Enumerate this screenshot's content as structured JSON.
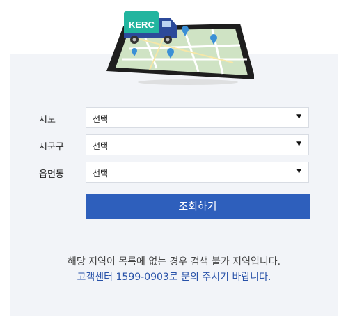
{
  "hero": {
    "badge_text": "KERC",
    "icon": "tablet-map-truck-illustration"
  },
  "form": {
    "rows": [
      {
        "label": "시도",
        "value": "선택"
      },
      {
        "label": "시군구",
        "value": "선택"
      },
      {
        "label": "읍면동",
        "value": "선택"
      }
    ],
    "caret": "▼",
    "submit_label": "조회하기"
  },
  "notice": {
    "line1": "해당 지역이 목록에 없는 경우 검색 불가 지역입니다.",
    "line2": "고객센터 1599-0903로 문의 주시기 바랍니다."
  },
  "colors": {
    "accent": "#2e5fbc",
    "panel_bg": "#f2f4f8",
    "link_text": "#2751a8"
  }
}
